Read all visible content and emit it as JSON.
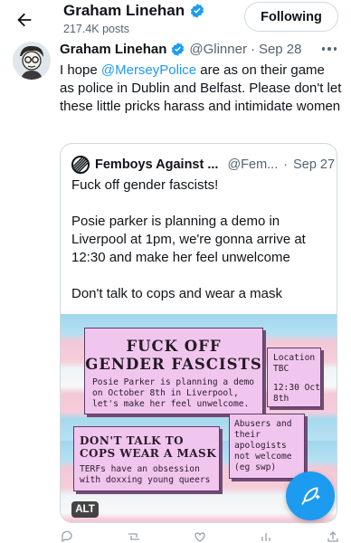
{
  "header": {
    "profile_name": "Graham Linehan",
    "post_count": "217.4K posts",
    "following_label": "Following"
  },
  "tweet": {
    "author_name": "Graham Linehan",
    "handle": "@Glinner",
    "separator": "·",
    "date": "Sep 28",
    "text_before_mention": "I hope ",
    "mention": "@MerseyPolice",
    "text_after_mention": " are as on their game as police in Dublin and Belfast. Please don't let these little pricks harass and intimidate women"
  },
  "quoted_tweet": {
    "author_name": "Femboys Against ...",
    "handle": "@Fem...",
    "separator": "·",
    "date": "Sep 27",
    "paragraphs": [
      "Fuck off gender fascists!",
      "Posie parker is planning a demo in Liverpool at 1pm, we're gonna arrive at 12:30 and make her feel unwelcome",
      "Don't talk to cops and wear a mask"
    ],
    "image": {
      "main_title_1": "FUCK OFF",
      "main_title_2": "GENDER FASCISTS",
      "main_body": "Posie Parker is planning a demo on October 8th in Liverpool, let's make her feel unwelcome.",
      "location_1": "Location TBC",
      "location_2": "12:30 Oct 8th",
      "cops_title": "DON'T TALK TO COPS WEAR A MASK",
      "cops_body": "TERFs have an obsession with doxxing young queers",
      "abusers": "Abusers and their apologists not welcome (eg swp)"
    },
    "alt_badge": "ALT"
  },
  "icons": {
    "back": "arrow-left-icon",
    "verified": "verified-badge-icon",
    "more": "more-dots-icon",
    "compose": "compose-feather-icon"
  },
  "colors": {
    "accent": "#1d9bf0",
    "text": "#0f1419",
    "muted": "#536471",
    "border": "#cfd9de"
  }
}
